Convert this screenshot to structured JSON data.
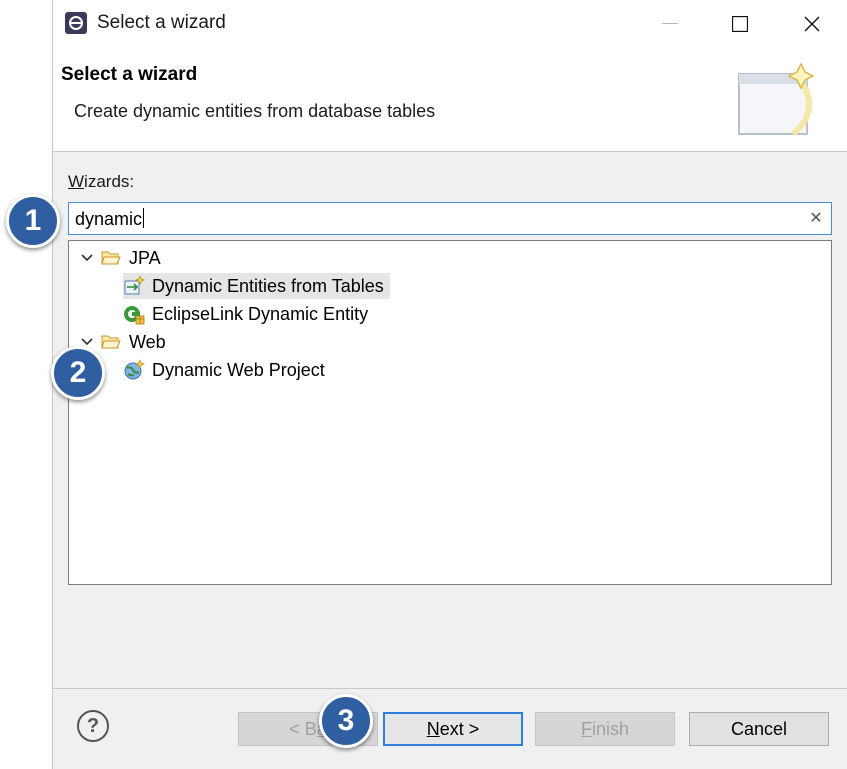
{
  "window": {
    "title": "Select a wizard"
  },
  "banner": {
    "title": "Select a wizard",
    "description": "Create dynamic entities from database tables"
  },
  "wizards": {
    "label_prefix": "W",
    "label_rest": "izards:",
    "filter_value": "dynamic",
    "clear_symbol": "✕"
  },
  "tree": {
    "categories": [
      {
        "label": "JPA",
        "expanded": true,
        "items": [
          {
            "label": "Dynamic Entities from Tables",
            "icon": "entities-from-tables-icon",
            "selected": true
          },
          {
            "label": "EclipseLink Dynamic Entity",
            "icon": "eclipselink-entity-icon",
            "selected": false
          }
        ]
      },
      {
        "label": "Web",
        "expanded": true,
        "items": [
          {
            "label": "Dynamic Web Project",
            "icon": "web-project-icon",
            "selected": false
          }
        ]
      }
    ]
  },
  "buttons": {
    "help": "?",
    "back_prefix": "< B",
    "back_rest": "a",
    "next_prefix": "N",
    "next_rest": "ext >",
    "finish_prefix": "F",
    "finish_rest": "inish",
    "cancel": "Cancel"
  },
  "markers": [
    "1",
    "2",
    "3"
  ],
  "colors": {
    "accent": "#2d7fd8",
    "marker": "#2f5fa0",
    "selection": "#e5e5e5"
  }
}
